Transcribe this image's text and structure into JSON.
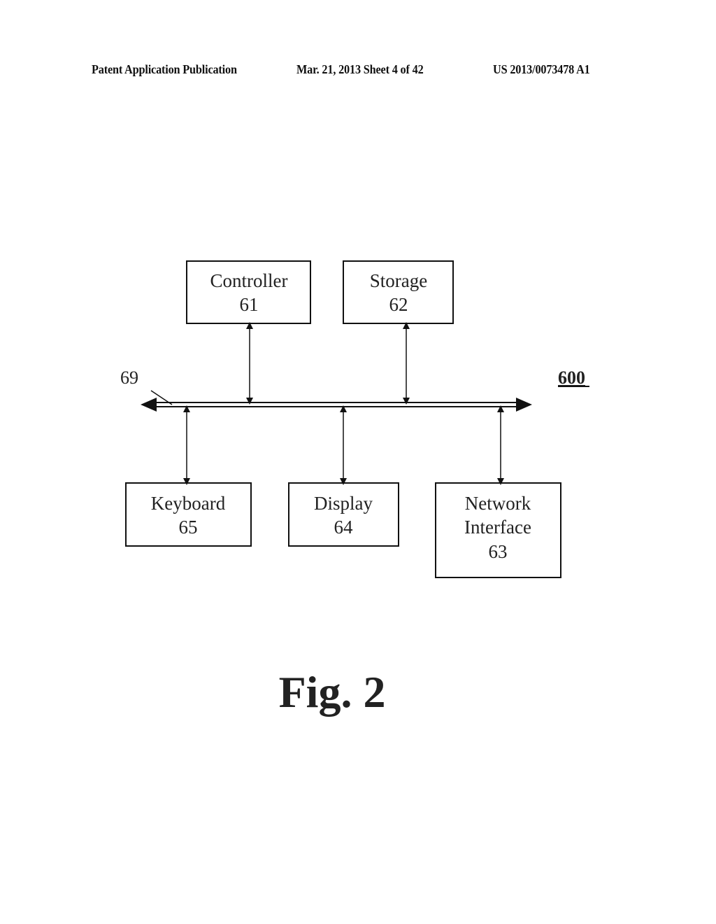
{
  "header": {
    "publication_type": "Patent Application Publication",
    "date_sheet": "Mar. 21, 2013  Sheet 4 of 42",
    "publication_number": "US 2013/0073478 A1"
  },
  "diagram": {
    "figure_ref": "600",
    "bus_ref": "69",
    "boxes": {
      "controller": {
        "title": "Controller",
        "ref": "61"
      },
      "storage": {
        "title": "Storage",
        "ref": "62"
      },
      "keyboard": {
        "title": "Keyboard",
        "ref": "65"
      },
      "display": {
        "title": "Display",
        "ref": "64"
      },
      "network": {
        "title_line1": "Network",
        "title_line2": "Interface",
        "ref": "63"
      }
    },
    "connections": [
      {
        "from": "controller",
        "to": "bus",
        "direction": "bidirectional"
      },
      {
        "from": "storage",
        "to": "bus",
        "direction": "bidirectional"
      },
      {
        "from": "keyboard",
        "to": "bus",
        "direction": "bidirectional"
      },
      {
        "from": "display",
        "to": "bus",
        "direction": "bidirectional"
      },
      {
        "from": "network",
        "to": "bus",
        "direction": "bidirectional"
      }
    ]
  },
  "caption": "Fig. 2"
}
